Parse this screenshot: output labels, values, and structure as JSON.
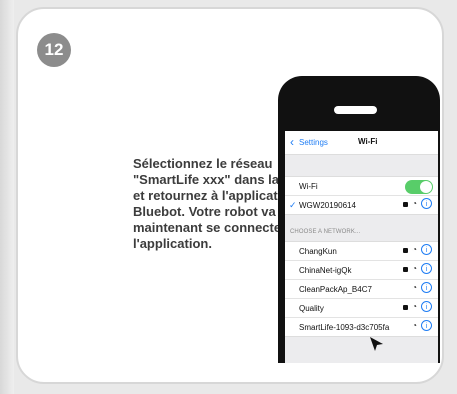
{
  "step": {
    "number": "12"
  },
  "instruction": {
    "text": "Sélectionnez le réseau \"SmartLife xxx\" dans la liste et retournez à l'application Bluebot. Votre robot va maintenant se connecter à l'application."
  },
  "phone": {
    "nav": {
      "back_label": "Settings",
      "title": "Wi-Fi"
    },
    "wifi": {
      "label": "Wi-Fi",
      "enabled": true,
      "connected_network": "WGW20190614"
    },
    "section_header": "CHOOSE A NETWORK...",
    "networks": [
      {
        "name": "ChangKun",
        "locked": true
      },
      {
        "name": "ChinaNet-igQk",
        "locked": true
      },
      {
        "name": "CleanPackAp_B4C7",
        "locked": false
      },
      {
        "name": "Quality",
        "locked": true
      },
      {
        "name": "SmartLife-1093-d3c705fa",
        "locked": false
      }
    ]
  },
  "colors": {
    "accent": "#1f7df4",
    "toggle_on": "#58cd69",
    "badge": "#8c8c8c"
  },
  "icons": {
    "back": "chevron-left-icon",
    "check": "checkmark-icon",
    "lock": "lock-icon",
    "wifi": "wifi-icon",
    "info": "info-icon",
    "cursor": "cursor-icon"
  }
}
